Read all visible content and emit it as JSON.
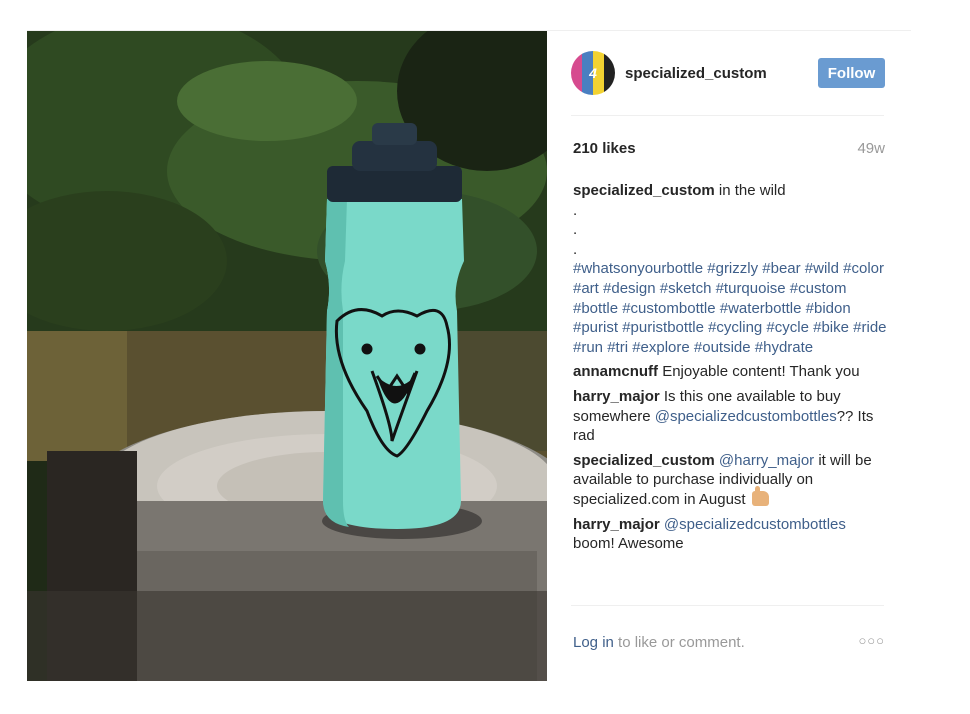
{
  "post": {
    "image": {
      "alt": "turquoise water bottle with bear illustration on tree stump"
    },
    "author": {
      "username": "specialized_custom",
      "avatar_colors": [
        "#d64b8f",
        "#4a7fc1",
        "#f2d232",
        "#222222"
      ],
      "avatar_logo": "4"
    },
    "follow_label": "Follow",
    "likes": "210 likes",
    "age": "49w",
    "caption": {
      "author": "specialized_custom",
      "text": "in the wild",
      "dots": [
        ".",
        ".",
        "."
      ],
      "hashtags": "#whatsonyourbottle #grizzly #bear #wild #color #art #design #sketch #turquoise #custom #bottle #custombottle #waterbottle #bidon #purist #puristbottle #cycling #cycle #bike #ride #run #tri #explore #outside #hydrate"
    },
    "comments": [
      {
        "author": "annamcnuff",
        "text": "Enjoyable content! Thank you"
      },
      {
        "author": "harry_major",
        "pre": "Is this one available to buy somewhere",
        "mention": "@specializedcustombottles",
        "post": "?? Its rad"
      },
      {
        "author": "specialized_custom",
        "mention": "@harry_major",
        "post": "it will be available to purchase individually on specialized.com in August"
      },
      {
        "author": "harry_major",
        "mention": "@specializedcustombottles",
        "post": "boom! Awesome"
      }
    ],
    "footer": {
      "login_label": "Log in",
      "rest": "to like or comment."
    },
    "more_icon": "ellipsis-icon",
    "more_glyph": "○○○"
  }
}
